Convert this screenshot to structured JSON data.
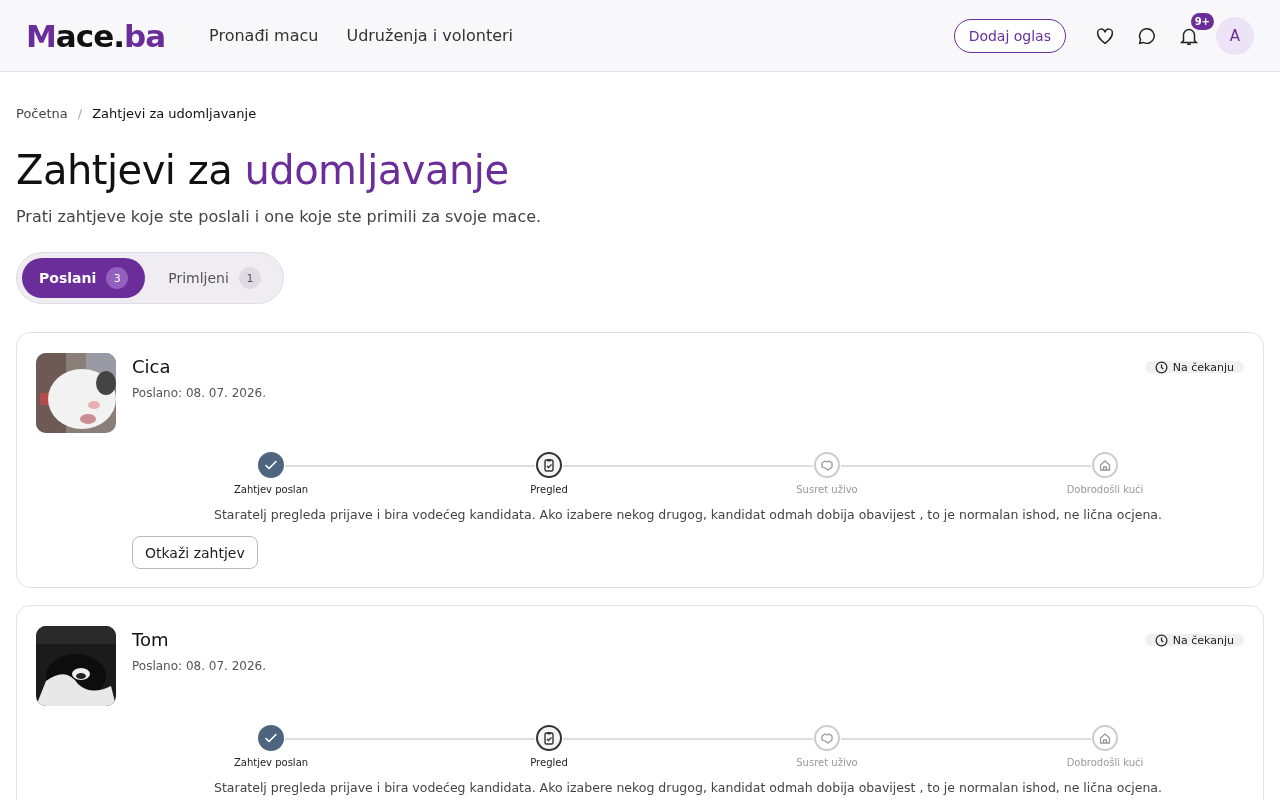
{
  "header": {
    "logo": [
      {
        "text": "M",
        "accent": true
      },
      {
        "text": "ace.",
        "accent": false
      },
      {
        "text": "ba",
        "accent": true
      }
    ],
    "nav": [
      "Pronađi macu",
      "Udruženja i volonteri"
    ],
    "add_button": "Dodaj oglas",
    "notification_badge": "9+",
    "avatar": "A"
  },
  "breadcrumb": {
    "separator": "/",
    "items": [
      {
        "label": "Početna",
        "current": false
      },
      {
        "label": "Zahtjevi za udomljavanje",
        "current": true
      }
    ]
  },
  "title": [
    {
      "text": "Zahtjevi za ",
      "accent": false
    },
    {
      "text": "udomljavanje",
      "accent": true
    }
  ],
  "subtitle": "Prati zahtjeve koje ste poslali i one koje ste primili za svoje mace.",
  "tabs": [
    {
      "label": "Poslani",
      "count": "3",
      "selected": true
    },
    {
      "label": "Primljeni",
      "count": "1",
      "selected": false
    }
  ],
  "requests": [
    {
      "name": "Cica",
      "sent": "Poslano: 08. 07. 2026.",
      "status": "Na čekanju",
      "steps": [
        {
          "label": "Zahtjev poslan",
          "kind": "done"
        },
        {
          "label": "Pregled",
          "kind": "current"
        },
        {
          "label": "Susret uživo",
          "kind": "pending"
        },
        {
          "label": "Dobrodošli kući",
          "kind": "pending"
        }
      ],
      "note": "Staratelj pregleda prijave i bira vodećeg kandidata. Ako izabere nekog drugog, kandidat odmah dobija obavijest , to je normalan ishod, ne lična ocjena.",
      "cancel_button": "Otkaži zahtjev"
    },
    {
      "name": "Tom",
      "sent": "Poslano: 08. 07. 2026.",
      "status": "Na čekanju",
      "steps": [
        {
          "label": "Zahtjev poslan",
          "kind": "done"
        },
        {
          "label": "Pregled",
          "kind": "current"
        },
        {
          "label": "Susret uživo",
          "kind": "pending"
        },
        {
          "label": "Dobrodošli kući",
          "kind": "pending"
        }
      ],
      "note": "Staratelj pregleda prijave i bira vodećeg kandidata. Ako izabere nekog drugog, kandidat odmah dobija obavijest , to je normalan ishod, ne lična ocjena."
    }
  ]
}
